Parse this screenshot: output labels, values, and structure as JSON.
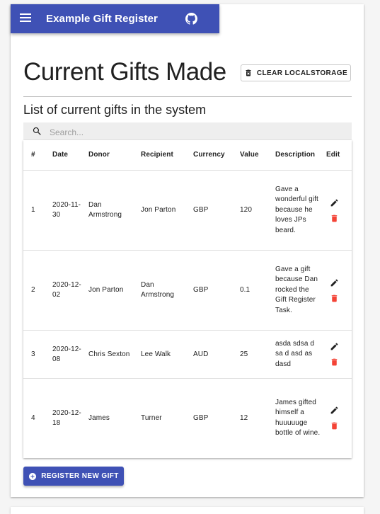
{
  "app_bar": {
    "title": "Example Gift Register",
    "menu_icon": "hamburger-menu-icon",
    "github_icon": "github-icon",
    "color": "#3f51b5"
  },
  "header": {
    "title": "Current Gifts Made",
    "clear_button_label": "CLEAR LOCALSTORAGE",
    "clear_button_icon": "trash-bin-icon",
    "subtitle": "List of current gifts in the system"
  },
  "search": {
    "placeholder": "Search...",
    "value": ""
  },
  "table": {
    "headers": [
      "#",
      "Date",
      "Donor",
      "Recipient",
      "Currency",
      "Value",
      "Description",
      "Edit"
    ],
    "rows": [
      {
        "id": "1",
        "date": "2020-11-30",
        "donor": "Dan Armstrong",
        "recipient": "Jon Parton",
        "currency": "GBP",
        "value": "120",
        "description": "Gave a wonderful gift because he loves JPs beard."
      },
      {
        "id": "2",
        "date": "2020-12-02",
        "donor": "Jon Parton",
        "recipient": "Dan Armstrong",
        "currency": "GBP",
        "value": "0.1",
        "description": "Gave a gift because Dan rocked the Gift Register Task."
      },
      {
        "id": "3",
        "date": "2020-12-08",
        "donor": "Chris Sexton",
        "recipient": "Lee Walk",
        "currency": "AUD",
        "value": "25",
        "description": "asda sdsa d sa d asd as dasd"
      },
      {
        "id": "4",
        "date": "2020-12-18",
        "donor": "James",
        "recipient": "Turner",
        "currency": "GBP",
        "value": "12",
        "description": "James gifted himself a huuuuuge bottle of wine."
      }
    ],
    "edit_icon": "pencil-icon",
    "delete_icon": "trash-icon",
    "delete_color": "#f44336"
  },
  "footer": {
    "register_button_label": "REGISTER NEW GIFT",
    "register_button_icon": "plus-circle-icon"
  }
}
